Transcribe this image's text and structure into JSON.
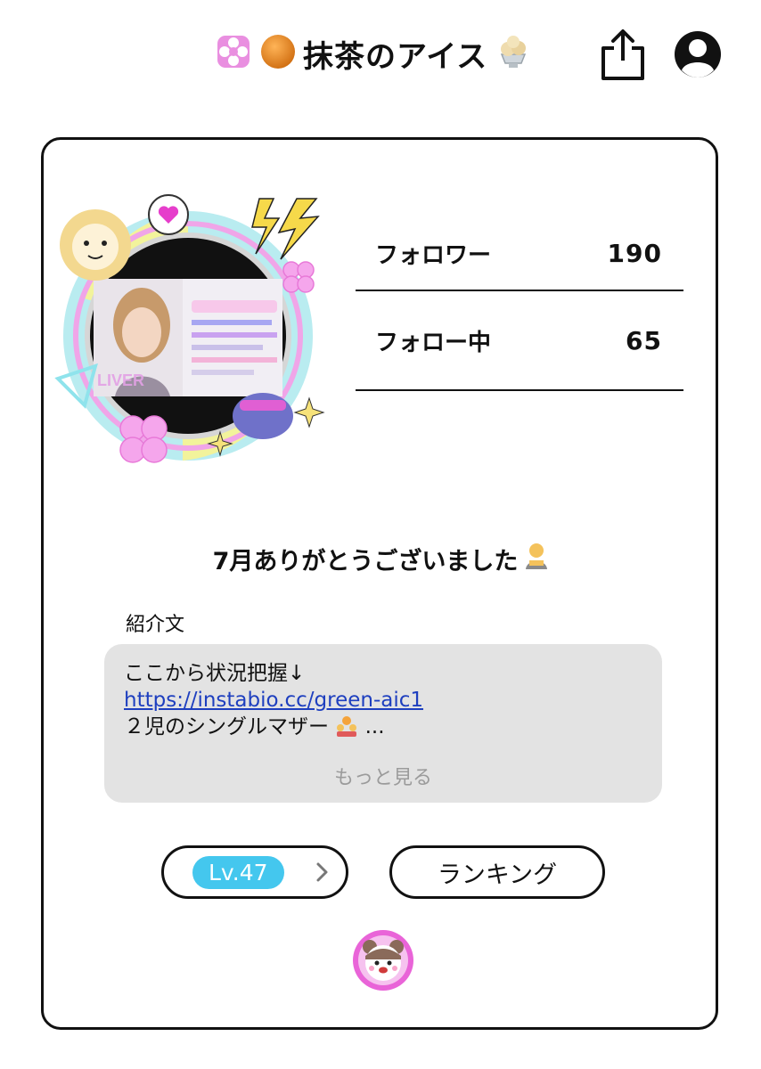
{
  "header": {
    "title": "抹茶のアイス",
    "icons": [
      "flower-icon",
      "orange-circle-icon",
      "ice-cream-icon",
      "share-icon",
      "account-icon"
    ]
  },
  "profile": {
    "stats": [
      {
        "label": "フォロワー",
        "value": "190"
      },
      {
        "label": "フォロー中",
        "value": "65"
      }
    ],
    "headline": "7月ありがとうございました",
    "intro_label": "紹介文",
    "bio": {
      "line1": "ここから状況把握↓",
      "link": "https://instabio.cc/green-aic1",
      "line3": "２児のシングルマザー",
      "ellipsis": "...",
      "more": "もっと見る"
    },
    "level": "Lv.47",
    "ranking": "ランキング"
  },
  "colors": {
    "level_badge": "#44c7ee",
    "link": "#1e3fbf",
    "bio_bg": "#e3e3e3"
  }
}
